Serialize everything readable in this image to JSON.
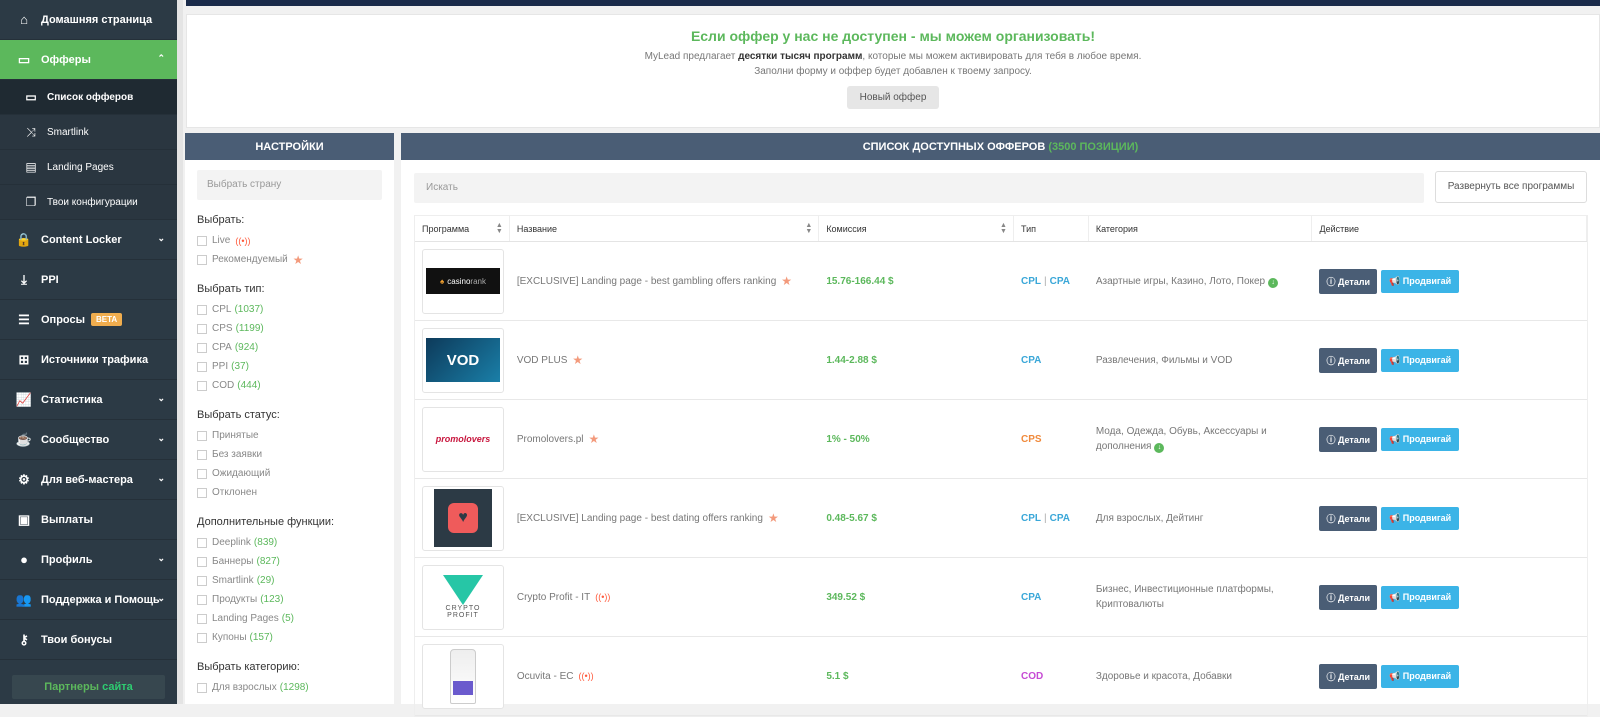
{
  "sidebar": {
    "items": [
      {
        "label": "Домашняя страница",
        "icon": "home-icon",
        "chevron": false
      },
      {
        "label": "Офферы",
        "icon": "monitor-icon",
        "chevron": true,
        "active": true
      },
      {
        "label": "Content Locker",
        "icon": "lock-icon",
        "chevron": true
      },
      {
        "label": "PPI",
        "icon": "download-icon",
        "chevron": false
      },
      {
        "label": "Опросы",
        "icon": "list-icon",
        "chevron": false,
        "badge": "BETA"
      },
      {
        "label": "Источники трафика",
        "icon": "sitemap-icon",
        "chevron": false
      },
      {
        "label": "Статистика",
        "icon": "chart-icon",
        "chevron": true
      },
      {
        "label": "Сообщество",
        "icon": "community-icon",
        "chevron": true
      },
      {
        "label": "Для веб-мастера",
        "icon": "cogs-icon",
        "chevron": true
      },
      {
        "label": "Выплаты",
        "icon": "money-icon",
        "chevron": false
      },
      {
        "label": "Профиль",
        "icon": "user-icon",
        "chevron": true
      },
      {
        "label": "Поддержка и Помощь",
        "icon": "users-icon",
        "chevron": true
      },
      {
        "label": "Твои бонусы",
        "icon": "key-icon",
        "chevron": false
      }
    ],
    "sub_items": [
      {
        "label": "Список офферов",
        "icon": "monitor-icon",
        "current": true
      },
      {
        "label": "Smartlink",
        "icon": "shuffle-icon"
      },
      {
        "label": "Landing Pages",
        "icon": "page-icon"
      },
      {
        "label": "Твои конфигурации",
        "icon": "copy-icon"
      }
    ],
    "partners_label": "Партнеры",
    "partners_label_2": "сайта"
  },
  "promo": {
    "title": "Если оффер у нас не доступен - мы можем организовать!",
    "line1_a": "MyLead предлагает ",
    "line1_b": "десятки тысяч программ",
    "line1_c": ", которые мы можем активировать для тебя в любое время.",
    "line2": "Заполни форму и оффер будет добавлен к твоему запросу.",
    "button": "Новый оффер"
  },
  "settings": {
    "header": "НАСТРОЙКИ",
    "country_placeholder": "Выбрать страну",
    "groups": [
      {
        "title": "Выбрать:",
        "options": [
          {
            "label": "Live",
            "live": "((•))"
          },
          {
            "label": "Рекомендуемый",
            "star": "★"
          }
        ]
      },
      {
        "title": "Выбрать тип:",
        "options": [
          {
            "label": "CPL",
            "count": "(1037)"
          },
          {
            "label": "CPS",
            "count": "(1199)"
          },
          {
            "label": "CPA",
            "count": "(924)"
          },
          {
            "label": "PPI",
            "count": "(37)"
          },
          {
            "label": "COD",
            "count": "(444)"
          }
        ]
      },
      {
        "title": "Выбрать статус:",
        "options": [
          {
            "label": "Принятые"
          },
          {
            "label": "Без заявки"
          },
          {
            "label": "Ожидающий"
          },
          {
            "label": "Отклонен"
          }
        ]
      },
      {
        "title": "Дополнительные функции:",
        "options": [
          {
            "label": "Deeplink",
            "count": "(839)"
          },
          {
            "label": "Баннеры",
            "count": "(827)"
          },
          {
            "label": "Smartlink",
            "count": "(29)"
          },
          {
            "label": "Продукты",
            "count": "(123)"
          },
          {
            "label": "Landing Pages",
            "count": "(5)"
          },
          {
            "label": "Купоны",
            "count": "(157)"
          }
        ]
      },
      {
        "title": "Выбрать категорию:",
        "options": [
          {
            "label": "Для взрослых",
            "count": "(1298)"
          }
        ]
      }
    ]
  },
  "offers": {
    "header": "СПИСОК ДОСТУПНЫХ ОФФЕРОВ",
    "header_count": "(3500 ПОЗИЦИИ)",
    "search_placeholder": "Искать",
    "expand_button": "Развернуть все программы",
    "columns": [
      "Программа",
      "Название",
      "Комиссия",
      "Тип",
      "Категория",
      "Действие"
    ],
    "details_label": "Детали",
    "promote_label": "Продвигай",
    "rows": [
      {
        "logo": "casino-rank-logo",
        "name": "[EXCLUSIVE] Landing page - best gambling offers ranking",
        "mark": "star",
        "commission": "15.76-166.44 $",
        "types": [
          "CPL",
          "CPA"
        ],
        "category": "Азартные игры, Казино, Лото, Покер",
        "more": true
      },
      {
        "logo": "vod-plus-logo",
        "name": "VOD PLUS",
        "mark": "star",
        "commission": "1.44-2.88 $",
        "types": [
          "CPA"
        ],
        "category": "Развлечения, Фильмы и VOD",
        "more": false
      },
      {
        "logo": "promolovers-logo",
        "name": "Promolovers.pl",
        "mark": "star",
        "commission": "1% - 50%",
        "types": [
          "CPS"
        ],
        "category": "Мода, Одежда, Обувь, Аксессуары и дополнения",
        "more": true
      },
      {
        "logo": "dating-logo",
        "name": "[EXCLUSIVE] Landing page - best dating offers ranking",
        "mark": "star",
        "commission": "0.48-5.67 $",
        "types": [
          "CPL",
          "CPA"
        ],
        "category": "Для взрослых, Дейтинг",
        "more": false
      },
      {
        "logo": "crypto-profit-logo",
        "name": "Crypto Profit - IT",
        "mark": "live",
        "commission": "349.52 $",
        "types": [
          "CPA"
        ],
        "category": "Бизнес, Инвестиционные платформы, Криптовалюты",
        "more": false
      },
      {
        "logo": "ocuvita-logo",
        "name": "Ocuvita - EC",
        "mark": "live",
        "commission": "5.1 $",
        "types": [
          "COD"
        ],
        "category": "Здоровье и красота, Добавки",
        "more": false
      }
    ]
  },
  "logo_text": {
    "casino": "casino",
    "rank": "rank",
    "vod": "VOD",
    "promolovers": "promolovers",
    "crypto": "CRYPTO",
    "profit": "PROFIT"
  }
}
